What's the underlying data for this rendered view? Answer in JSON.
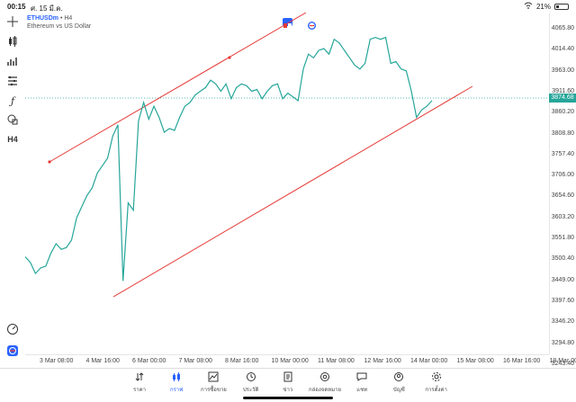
{
  "status": {
    "time": "00:15",
    "date": "ศ. 15 มี.ค.",
    "battery": "21%"
  },
  "symbol": {
    "name": "ETHUSDm",
    "timeframe": "H4",
    "description": "Ethereum vs US Dollar"
  },
  "price_axis": [
    "4065.80",
    "4014.40",
    "3963.00",
    "3911.60",
    "3860.20",
    "3808.80",
    "3757.40",
    "3706.00",
    "3654.60",
    "3603.20",
    "3551.80",
    "3500.40",
    "3449.00",
    "3397.60",
    "3346.20",
    "3294.80",
    "3243.40"
  ],
  "current_price": "3874.68",
  "time_axis": [
    "3 Mar 08:00",
    "4 Mar 16:00",
    "6 Mar 00:00",
    "7 Mar 08:00",
    "8 Mar 16:00",
    "10 Mar 00:00",
    "11 Mar 08:00",
    "12 Mar 16:00",
    "14 Mar 00:00",
    "15 Mar 08:00",
    "16 Mar 16:00",
    "18 Mar 00:00"
  ],
  "tools": [
    "crosshair-icon",
    "candles-icon",
    "bars-icon",
    "indicators-icon",
    "function-icon",
    "shapes-icon",
    "timeframe-label"
  ],
  "timeframe_tool": "H4",
  "nav": [
    {
      "label": "ราคา",
      "icon": "quotes-icon",
      "active": false
    },
    {
      "label": "กราฟ",
      "icon": "chart-icon",
      "active": true
    },
    {
      "label": "การซื้อขาย",
      "icon": "trade-icon",
      "active": false
    },
    {
      "label": "ประวัติ",
      "icon": "history-icon",
      "active": false
    },
    {
      "label": "ข่าว",
      "icon": "news-icon",
      "active": false
    },
    {
      "label": "กล่องจดหมาย",
      "icon": "mailbox-icon",
      "active": false
    },
    {
      "label": "แชท",
      "icon": "chat-icon",
      "active": false
    },
    {
      "label": "บัญชี",
      "icon": "account-icon",
      "active": false
    },
    {
      "label": "การตั้งค่า",
      "icon": "settings-icon",
      "active": false
    }
  ],
  "chart_data": {
    "type": "line",
    "ylim": [
      3243.4,
      4065.8
    ],
    "line_color": "#26a69a",
    "channel_color": "#e53935",
    "price": [
      3455,
      3440,
      3410,
      3425,
      3430,
      3465,
      3490,
      3475,
      3480,
      3500,
      3560,
      3590,
      3620,
      3640,
      3680,
      3700,
      3720,
      3780,
      3810,
      3390,
      3600,
      3580,
      3820,
      3870,
      3825,
      3860,
      3830,
      3790,
      3800,
      3795,
      3830,
      3860,
      3870,
      3890,
      3900,
      3910,
      3930,
      3920,
      3900,
      3920,
      3880,
      3910,
      3920,
      3915,
      3900,
      3905,
      3880,
      3900,
      3915,
      3920,
      3880,
      3895,
      3885,
      3875,
      3960,
      4000,
      3990,
      4010,
      4015,
      4000,
      4040,
      4030,
      4010,
      3990,
      3970,
      3960,
      3975,
      4040,
      4045,
      4040,
      4045,
      3975,
      3980,
      3960,
      3955,
      3900,
      3830,
      3850,
      3860,
      3875
    ]
  }
}
